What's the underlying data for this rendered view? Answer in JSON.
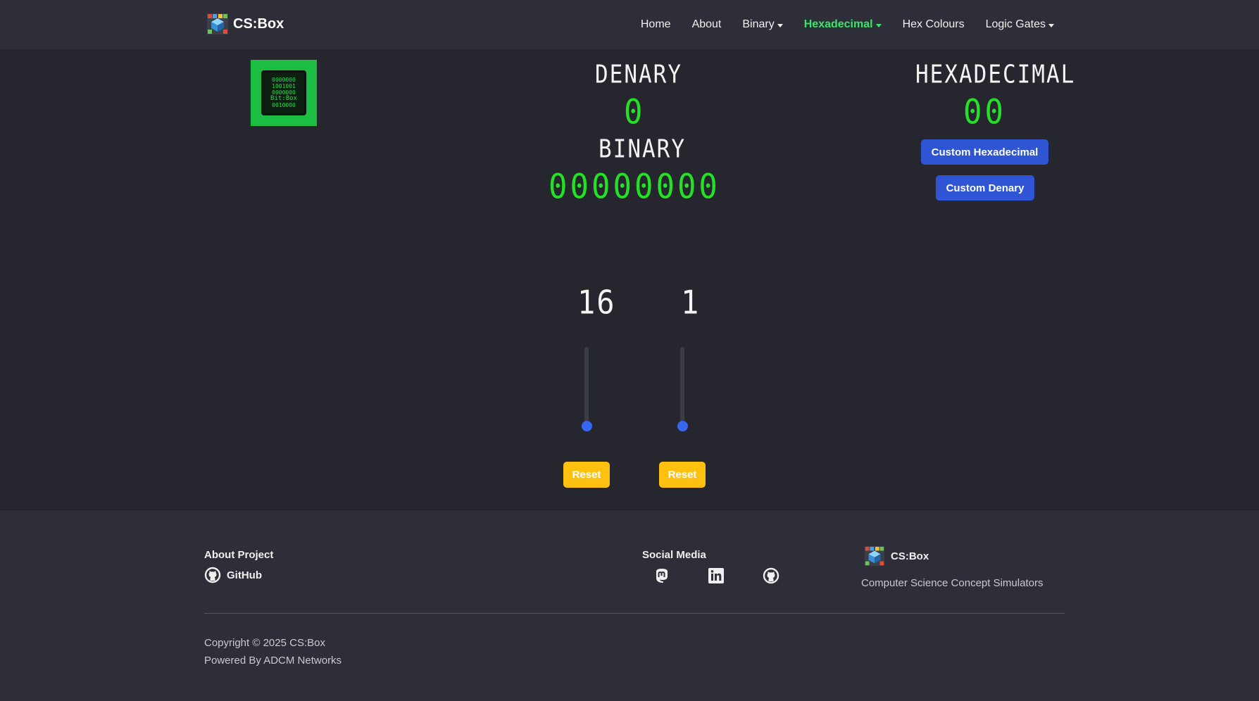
{
  "nav": {
    "brand": "CS:Box",
    "items": [
      {
        "label": "Home",
        "dropdown": false,
        "active": false
      },
      {
        "label": "About",
        "dropdown": false,
        "active": false
      },
      {
        "label": "Binary",
        "dropdown": true,
        "active": false
      },
      {
        "label": "Hexadecimal",
        "dropdown": true,
        "active": true
      },
      {
        "label": "Hex Colours",
        "dropdown": false,
        "active": false
      },
      {
        "label": "Logic Gates",
        "dropdown": true,
        "active": false
      }
    ],
    "active_color": "#3ee36b"
  },
  "bitbox": {
    "lines": [
      "0000000",
      "1001001",
      "0000000",
      "Bit:Box",
      "0010000"
    ]
  },
  "denary": {
    "heading": "DENARY",
    "value": "0"
  },
  "binary": {
    "heading": "BINARY",
    "value": "00000000"
  },
  "hexadecimal": {
    "heading": "HEXADECIMAL",
    "value": "00"
  },
  "buttons": {
    "custom_hex": "Custom Hexadecimal",
    "custom_denary": "Custom Denary"
  },
  "columns": [
    {
      "place_value": "16",
      "slider_level": 0,
      "reset_label": "Reset"
    },
    {
      "place_value": "1",
      "slider_level": 0,
      "reset_label": "Reset"
    }
  ],
  "footer": {
    "about_heading": "About Project",
    "github_label": "GitHub",
    "social_heading": "Social Media",
    "social_icons": [
      "mastodon-icon",
      "linkedin-icon",
      "github-icon"
    ],
    "brand": "CS:Box",
    "tagline": "Computer Science Concept Simulators",
    "copyright": "Copyright © 2025 CS:Box",
    "powered_by": "Powered By ADCM Networks"
  },
  "colors": {
    "background": "#26262f",
    "panel": "#2e2e38",
    "segment_green": "#25e125",
    "button_blue": "#2f55d4",
    "button_yellow": "#ffc10f",
    "slider_thumb": "#3767f0"
  }
}
